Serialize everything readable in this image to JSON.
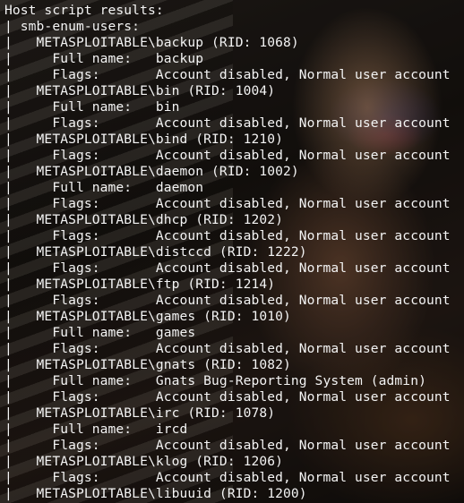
{
  "terminal": {
    "lines": [
      "Host script results:",
      "| smb-enum-users:",
      "|   METASPLOITABLE\\backup (RID: 1068)",
      "|     Full name:   backup",
      "|     Flags:       Account disabled, Normal user account",
      "|   METASPLOITABLE\\bin (RID: 1004)",
      "|     Full name:   bin",
      "|     Flags:       Account disabled, Normal user account",
      "|   METASPLOITABLE\\bind (RID: 1210)",
      "|     Flags:       Account disabled, Normal user account",
      "|   METASPLOITABLE\\daemon (RID: 1002)",
      "|     Full name:   daemon",
      "|     Flags:       Account disabled, Normal user account",
      "|   METASPLOITABLE\\dhcp (RID: 1202)",
      "|     Flags:       Account disabled, Normal user account",
      "|   METASPLOITABLE\\distccd (RID: 1222)",
      "|     Flags:       Account disabled, Normal user account",
      "|   METASPLOITABLE\\ftp (RID: 1214)",
      "|     Flags:       Account disabled, Normal user account",
      "|   METASPLOITABLE\\games (RID: 1010)",
      "|     Full name:   games",
      "|     Flags:       Account disabled, Normal user account",
      "|   METASPLOITABLE\\gnats (RID: 1082)",
      "|     Full name:   Gnats Bug-Reporting System (admin)",
      "|     Flags:       Account disabled, Normal user account",
      "|   METASPLOITABLE\\irc (RID: 1078)",
      "|     Full name:   ircd",
      "|     Flags:       Account disabled, Normal user account",
      "|   METASPLOITABLE\\klog (RID: 1206)",
      "|     Flags:       Account disabled, Normal user account",
      "|   METASPLOITABLE\\libuuid (RID: 1200)"
    ]
  }
}
